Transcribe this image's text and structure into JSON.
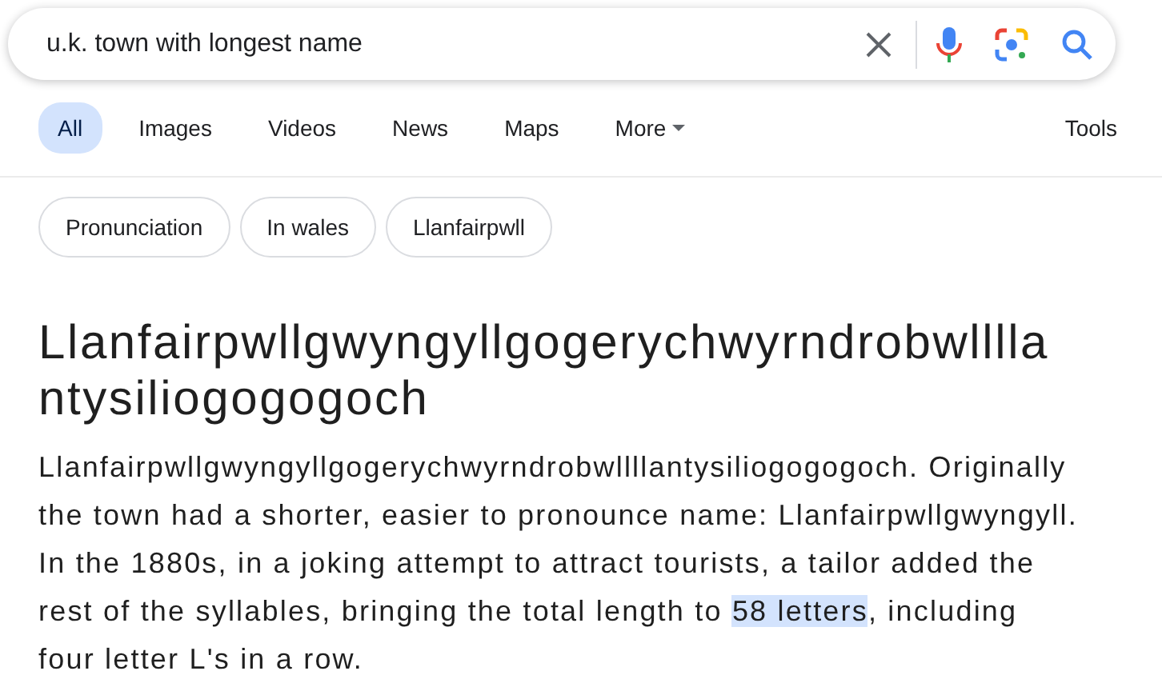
{
  "search": {
    "value": "u.k. town with longest name"
  },
  "tabs": [
    {
      "label": "All",
      "selected": true
    },
    {
      "label": "Images",
      "selected": false
    },
    {
      "label": "Videos",
      "selected": false
    },
    {
      "label": "News",
      "selected": false
    },
    {
      "label": "Maps",
      "selected": false
    },
    {
      "label": "More",
      "selected": false,
      "kind": "menu"
    }
  ],
  "tools": "Tools",
  "chips": [
    "Pronunciation",
    "In wales",
    "Llanfairpwll"
  ],
  "answer": {
    "title": "Llanfairpwllgwyngyllgogerychwyrndrobwllllantysiliogogogoch",
    "snippet": [
      {
        "text": "Llanfairpwllgwyngyllgogerychwyrndrobwllllantysiliogogogoch. Originally the town had a shorter, easier to pronounce name: Llanfairpwllgwyngyll. In the 1880s, in a joking attempt to attract tourists, a tailor added the rest of the syllables, bringing the total length to ",
        "highlighted": false
      },
      {
        "text": "58 letters",
        "highlighted": true
      },
      {
        "text": ", including four letter L's in a row.",
        "highlighted": false
      }
    ]
  }
}
